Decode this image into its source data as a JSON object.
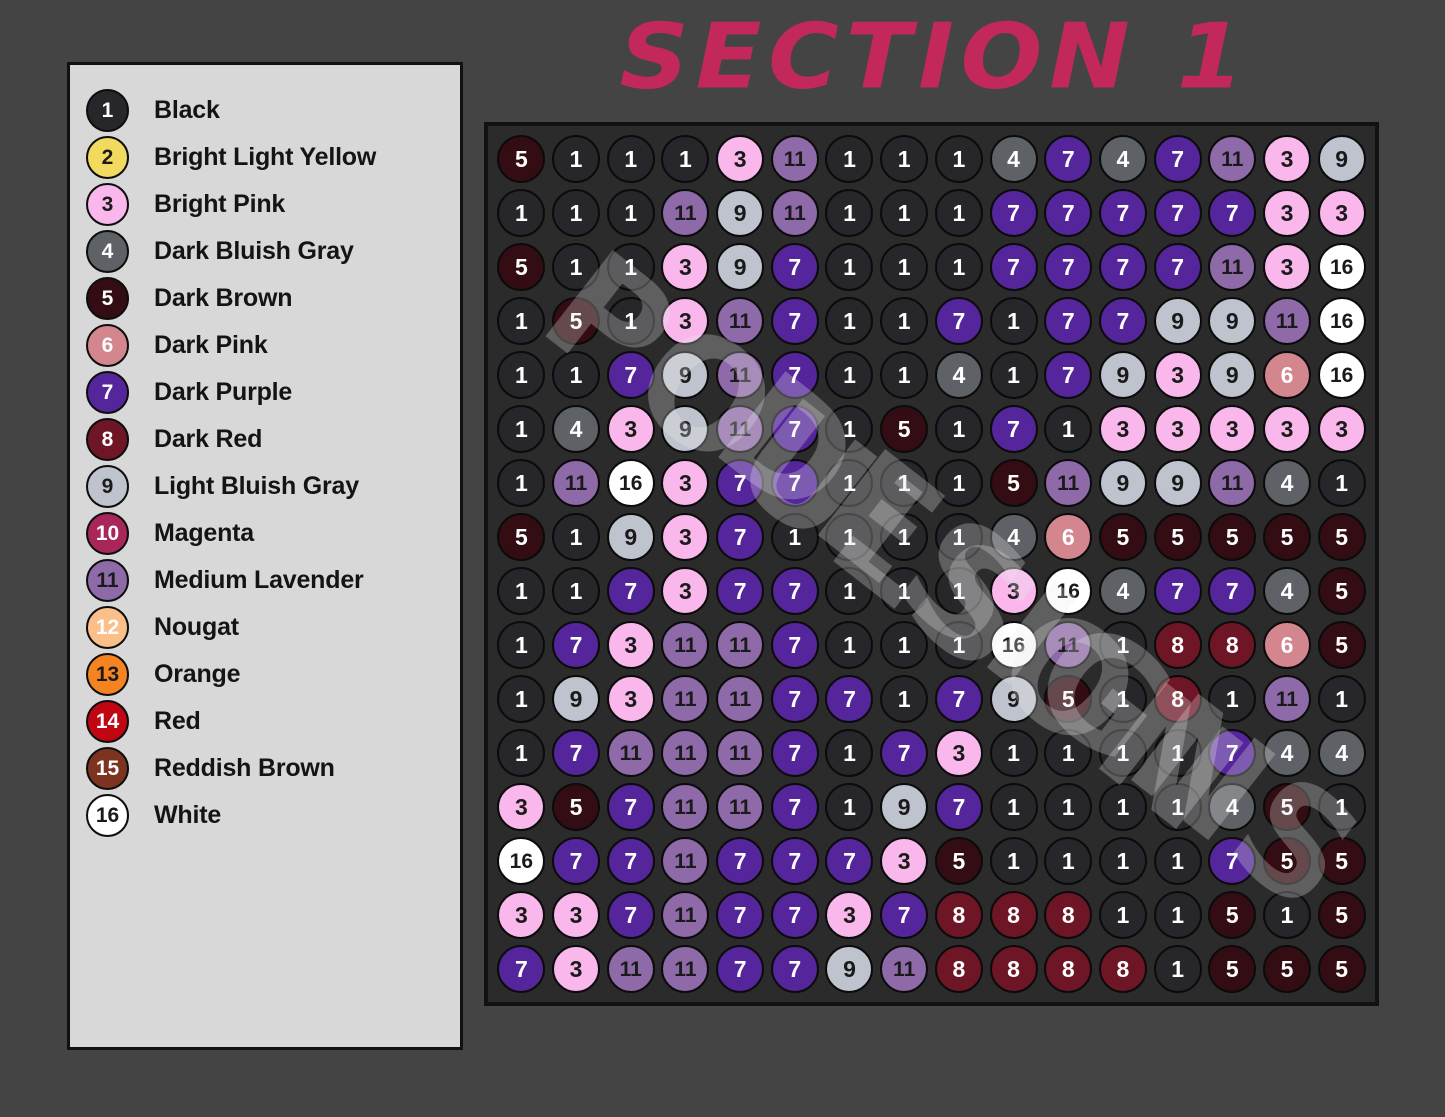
{
  "title": "SECTION 1",
  "watermark": {
    "line1": "POULSON",
    "line2": "DESIGNS"
  },
  "legend": {
    "items": [
      {
        "num": "1",
        "label": "Black",
        "fill": "#27262a",
        "text": "#ffffff"
      },
      {
        "num": "2",
        "label": "Bright Light Yellow",
        "fill": "#f2da5e",
        "text": "#1a1a1a"
      },
      {
        "num": "3",
        "label": "Bright Pink",
        "fill": "#f9b7ec",
        "text": "#1a1a1a"
      },
      {
        "num": "4",
        "label": "Dark Bluish Gray",
        "fill": "#5e6166",
        "text": "#ffffff"
      },
      {
        "num": "5",
        "label": "Dark Brown",
        "fill": "#330d13",
        "text": "#ffffff"
      },
      {
        "num": "6",
        "label": "Dark Pink",
        "fill": "#d4868f",
        "text": "#ffffff"
      },
      {
        "num": "7",
        "label": "Dark Purple",
        "fill": "#54259b",
        "text": "#ffffff"
      },
      {
        "num": "8",
        "label": "Dark Red",
        "fill": "#6e1626",
        "text": "#ffffff"
      },
      {
        "num": "9",
        "label": "Light Bluish Gray",
        "fill": "#bfc3cd",
        "text": "#1a1a1a"
      },
      {
        "num": "10",
        "label": "Magenta",
        "fill": "#a8265a",
        "text": "#ffffff"
      },
      {
        "num": "11",
        "label": "Medium Lavender",
        "fill": "#8f6aa8",
        "text": "#1a1a1a"
      },
      {
        "num": "12",
        "label": "Nougat",
        "fill": "#fbc08a",
        "text": "#ffffff"
      },
      {
        "num": "13",
        "label": "Orange",
        "fill": "#f58320",
        "text": "#1a1a1a"
      },
      {
        "num": "14",
        "label": "Red",
        "fill": "#c00612",
        "text": "#ffffff"
      },
      {
        "num": "15",
        "label": "Reddish Brown",
        "fill": "#7c3420",
        "text": "#ffffff"
      },
      {
        "num": "16",
        "label": "White",
        "fill": "#ffffff",
        "text": "#1a1a1a"
      }
    ]
  },
  "grid": {
    "rows": 16,
    "cols": 16,
    "cells": [
      [
        5,
        1,
        1,
        1,
        3,
        11,
        1,
        1,
        1,
        4,
        7,
        4,
        7,
        11,
        3,
        9
      ],
      [
        1,
        1,
        1,
        11,
        9,
        11,
        1,
        1,
        1,
        7,
        7,
        7,
        7,
        7,
        3,
        3
      ],
      [
        5,
        1,
        1,
        3,
        9,
        7,
        1,
        1,
        1,
        7,
        7,
        7,
        7,
        11,
        3,
        16
      ],
      [
        1,
        5,
        1,
        3,
        11,
        7,
        1,
        1,
        7,
        1,
        7,
        7,
        9,
        9,
        11,
        16
      ],
      [
        1,
        1,
        7,
        9,
        11,
        7,
        1,
        1,
        4,
        1,
        7,
        9,
        3,
        9,
        6,
        16
      ],
      [
        1,
        4,
        3,
        9,
        11,
        7,
        1,
        5,
        1,
        7,
        1,
        3,
        3,
        3,
        3,
        3
      ],
      [
        1,
        11,
        16,
        3,
        7,
        7,
        1,
        1,
        1,
        5,
        11,
        9,
        9,
        11,
        4,
        1
      ],
      [
        5,
        1,
        9,
        3,
        7,
        1,
        1,
        1,
        1,
        4,
        6,
        5,
        5,
        5,
        5,
        5
      ],
      [
        1,
        1,
        7,
        3,
        7,
        7,
        1,
        1,
        1,
        3,
        16,
        4,
        7,
        7,
        4,
        5
      ],
      [
        1,
        7,
        3,
        11,
        11,
        7,
        1,
        1,
        1,
        16,
        11,
        1,
        8,
        8,
        6,
        5
      ],
      [
        1,
        9,
        3,
        11,
        11,
        7,
        7,
        1,
        7,
        9,
        5,
        1,
        8,
        1,
        11,
        1
      ],
      [
        1,
        7,
        11,
        11,
        11,
        7,
        1,
        7,
        3,
        1,
        1,
        1,
        1,
        7,
        4,
        4
      ],
      [
        3,
        5,
        7,
        11,
        11,
        7,
        1,
        9,
        7,
        1,
        1,
        1,
        1,
        4,
        5,
        1
      ],
      [
        16,
        7,
        7,
        11,
        7,
        7,
        7,
        3,
        5,
        1,
        1,
        1,
        1,
        7,
        5,
        5
      ],
      [
        3,
        3,
        7,
        11,
        7,
        7,
        3,
        7,
        8,
        8,
        8,
        1,
        1,
        5,
        1,
        5
      ],
      [
        7,
        3,
        11,
        11,
        7,
        7,
        9,
        11,
        8,
        8,
        8,
        8,
        1,
        5,
        5,
        5
      ]
    ]
  }
}
